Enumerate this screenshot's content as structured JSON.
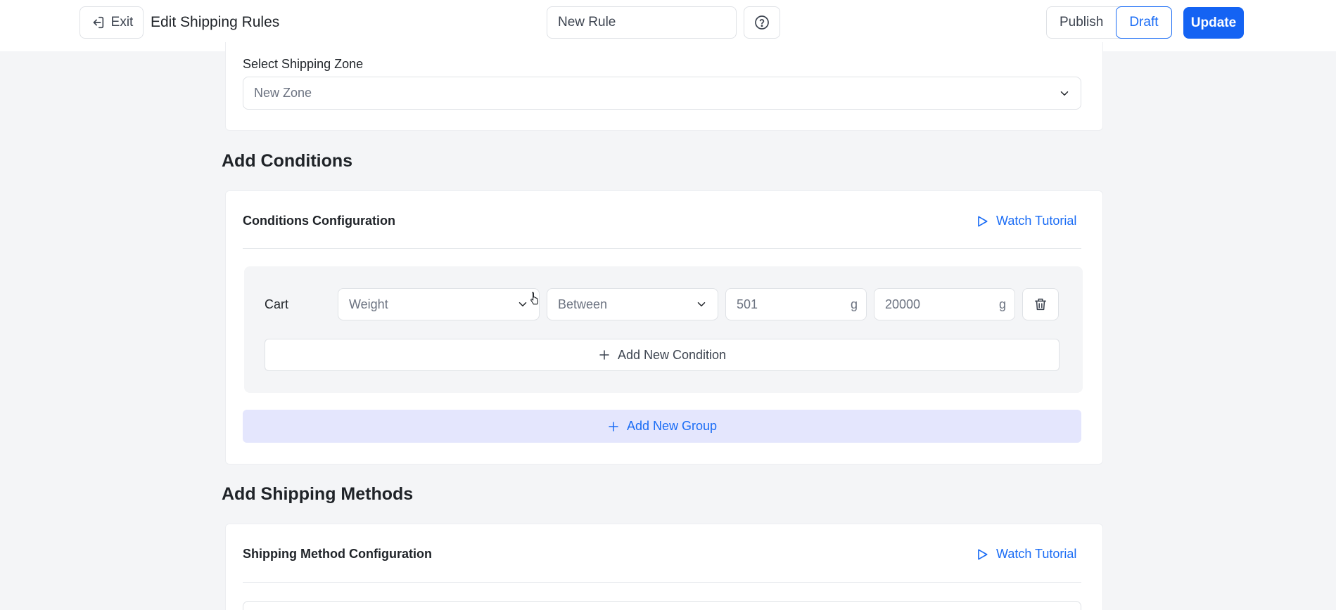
{
  "header": {
    "exit_label": "Exit",
    "title": "Edit Shipping Rules",
    "rule_name_value": "New Rule",
    "status_options": [
      "Publish",
      "Draft"
    ],
    "active_status": "Draft",
    "update_label": "Update"
  },
  "zone": {
    "label": "Select Shipping Zone",
    "selected": "New Zone"
  },
  "conditions": {
    "heading": "Add Conditions",
    "card_title": "Conditions Configuration",
    "tutorial_label": "Watch Tutorial",
    "row": {
      "scope": "Cart",
      "attribute": "Weight",
      "operator": "Between",
      "min_value": "501",
      "max_value": "20000",
      "unit": "g"
    },
    "add_condition_label": "Add New Condition",
    "add_group_label": "Add New Group"
  },
  "shipping_methods": {
    "heading": "Add Shipping Methods",
    "card_title": "Shipping Method Configuration",
    "tutorial_label": "Watch Tutorial"
  },
  "colors": {
    "accent": "#1463f3",
    "add_group_bg": "#e4e6fd",
    "page_bg": "#f4f5f7"
  },
  "icons": {
    "exit": "exit-icon",
    "help": "question-circle-icon",
    "chevron": "chevron-down-icon",
    "play": "play-icon",
    "trash": "trash-icon",
    "plus": "plus-icon"
  }
}
